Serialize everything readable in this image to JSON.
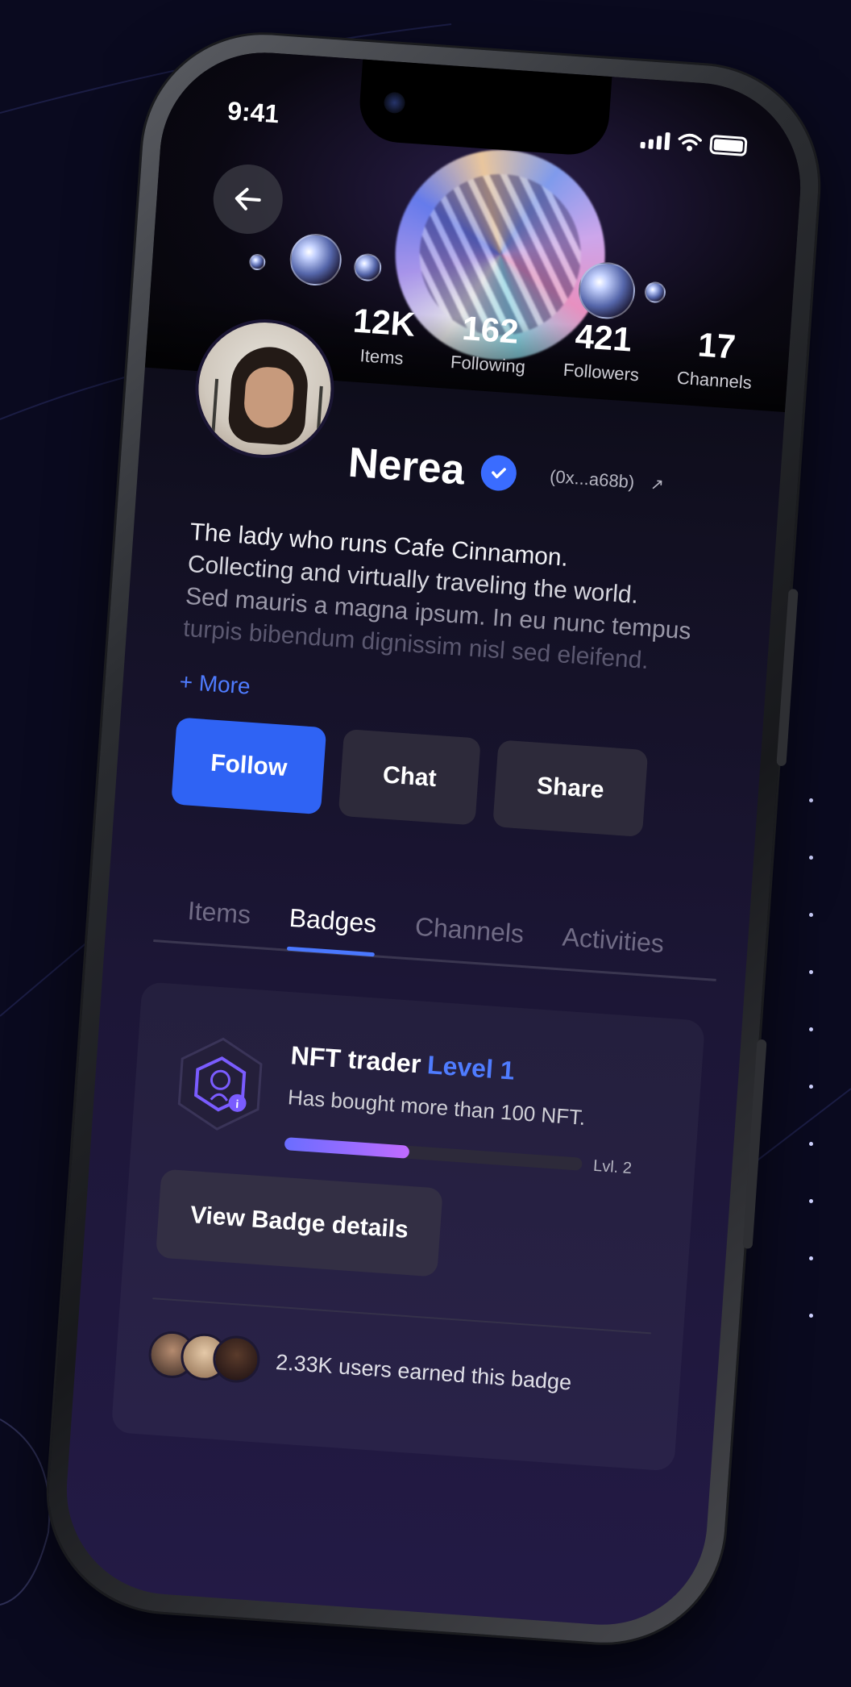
{
  "status_bar": {
    "time": "9:41"
  },
  "profile": {
    "name": "Nerea",
    "wallet": "(0x...a68b)",
    "stats": [
      {
        "value": "12K",
        "label": "Items"
      },
      {
        "value": "162",
        "label": "Following"
      },
      {
        "value": "421",
        "label": "Followers"
      },
      {
        "value": "17",
        "label": "Channels"
      }
    ],
    "bio": [
      "The lady who runs Cafe Cinnamon.",
      "Collecting and virtually traveling the world.",
      "Sed mauris a magna ipsum. In eu nunc tempus",
      "turpis bibendum dignissim nisl sed eleifend."
    ],
    "more_label": "+ More"
  },
  "actions": {
    "follow": "Follow",
    "chat": "Chat",
    "share": "Share"
  },
  "tabs": [
    {
      "label": "Items",
      "active": false
    },
    {
      "label": "Badges",
      "active": true
    },
    {
      "label": "Channels",
      "active": false
    },
    {
      "label": "Activities",
      "active": false
    }
  ],
  "badge": {
    "title": "NFT trader",
    "level": "Level 1",
    "description": "Has bought more than 100 NFT.",
    "progress": 0.42,
    "next_level_label": "Lvl. 2",
    "view_button": "View Badge details",
    "earned_text": "2.33K users earned this badge"
  },
  "colors": {
    "accent": "#2f63f4",
    "progress_start": "#6a6dff",
    "progress_end": "#c06bff",
    "background": "#0a0a1f"
  },
  "icons": [
    "back-arrow-icon",
    "verified-check-icon",
    "external-link-icon",
    "signal-icon",
    "wifi-icon",
    "battery-icon",
    "nft-badge-icon"
  ]
}
